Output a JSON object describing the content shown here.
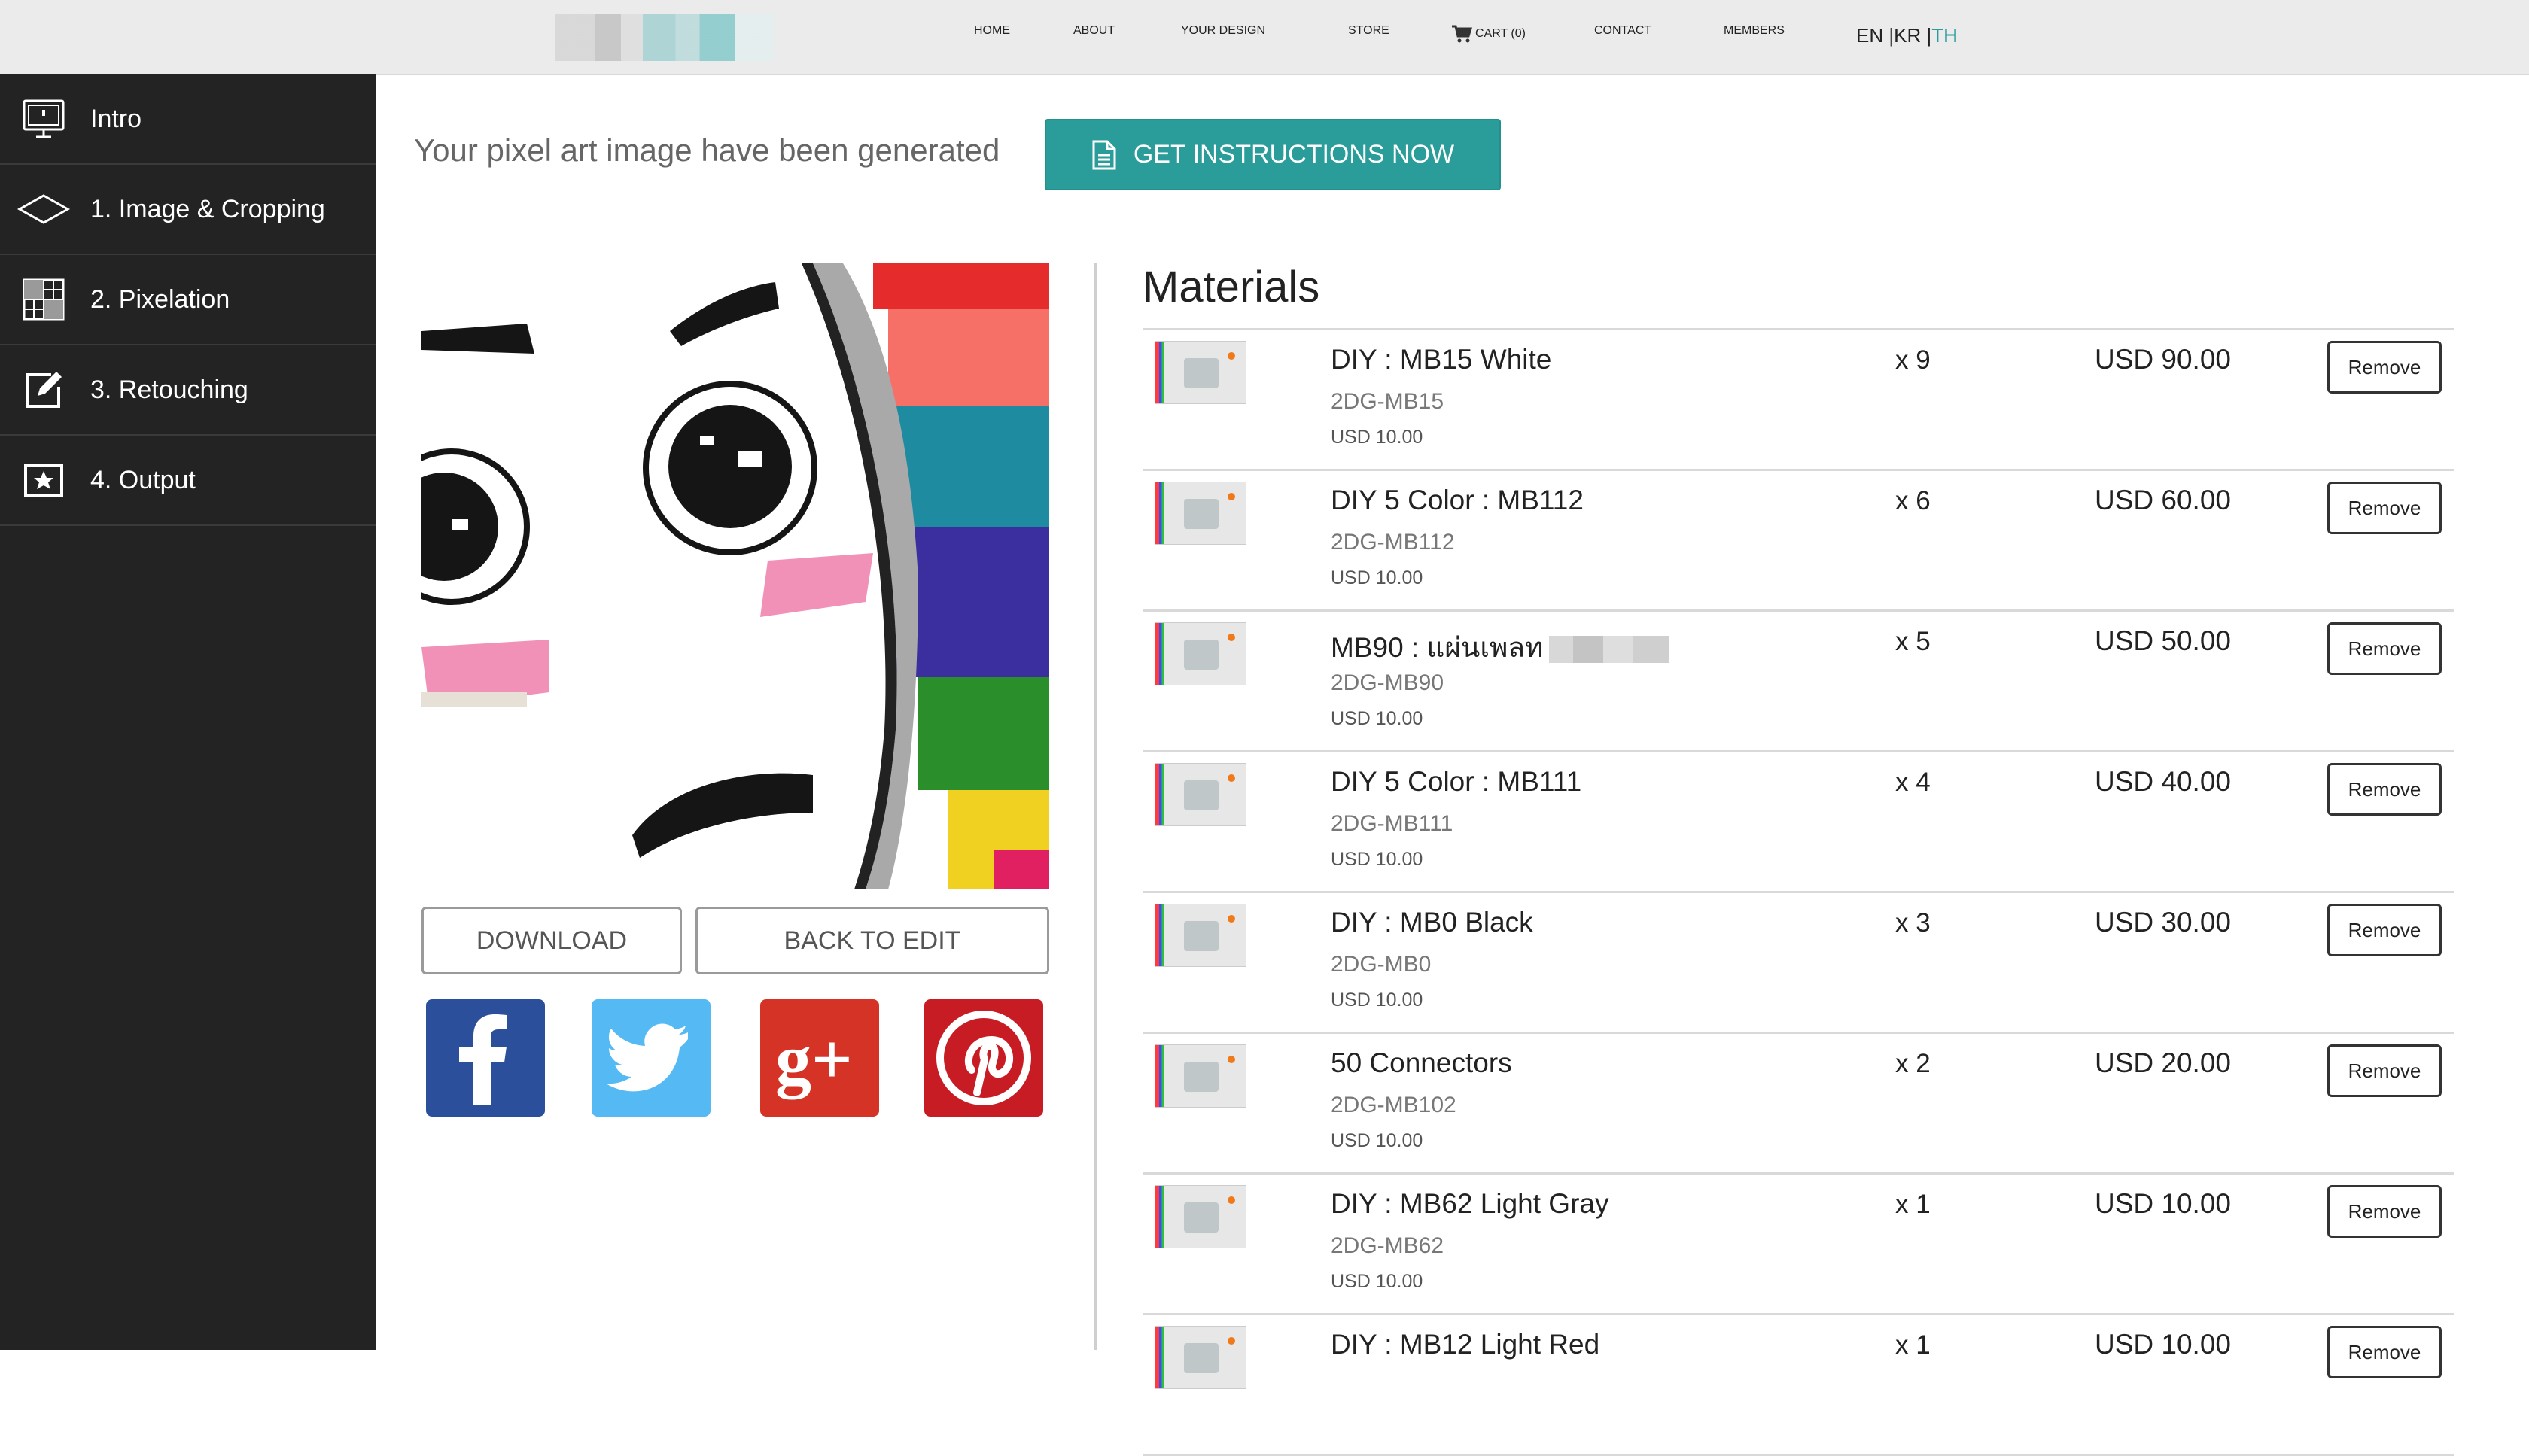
{
  "nav": {
    "items": [
      "HOME",
      "ABOUT",
      "YOUR DESIGN",
      "STORE",
      "CART (0)",
      "CONTACT",
      "MEMBERS"
    ],
    "lang": {
      "en": "EN",
      "kr": "KR",
      "th": "TH"
    }
  },
  "sidebar": {
    "items": [
      {
        "label": "Intro",
        "icon": "monitor-icon"
      },
      {
        "label": "1. Image & Cropping",
        "icon": "crop-icon"
      },
      {
        "label": "2. Pixelation",
        "icon": "pixel-grid-icon"
      },
      {
        "label": "3. Retouching",
        "icon": "edit-icon"
      },
      {
        "label": "4. Output",
        "icon": "star-icon"
      }
    ]
  },
  "main": {
    "generated_text": "Your pixel art image have been generated",
    "instructions_label": "GET INSTRUCTIONS NOW",
    "download_label": "DOWNLOAD",
    "back_label": "BACK TO EDIT"
  },
  "social": [
    "facebook",
    "twitter",
    "google-plus",
    "pinterest"
  ],
  "materials": {
    "title": "Materials",
    "remove_label": "Remove",
    "rows": [
      {
        "name": "DIY : MB15 White",
        "code": "2DG-MB15",
        "unit": "USD 10.00",
        "qty": "x 9",
        "total": "USD 90.00"
      },
      {
        "name": "DIY 5 Color : MB112",
        "code": "2DG-MB112",
        "unit": "USD 10.00",
        "qty": "x 6",
        "total": "USD 60.00"
      },
      {
        "name": "MB90 : แผ่นเพลท",
        "code": "2DG-MB90",
        "unit": "USD 10.00",
        "qty": "x 5",
        "total": "USD 50.00"
      },
      {
        "name": "DIY 5 Color : MB111",
        "code": "2DG-MB111",
        "unit": "USD 10.00",
        "qty": "x 4",
        "total": "USD 40.00"
      },
      {
        "name": "DIY : MB0 Black",
        "code": "2DG-MB0",
        "unit": "USD 10.00",
        "qty": "x 3",
        "total": "USD 30.00"
      },
      {
        "name": "50 Connectors",
        "code": "2DG-MB102",
        "unit": "USD 10.00",
        "qty": "x 2",
        "total": "USD 20.00"
      },
      {
        "name": "DIY : MB62 Light Gray",
        "code": "2DG-MB62",
        "unit": "USD 10.00",
        "qty": "x 1",
        "total": "USD 10.00"
      },
      {
        "name": "DIY : MB12 Light Red",
        "code": "",
        "unit": "",
        "qty": "x 1",
        "total": "USD 10.00"
      }
    ]
  },
  "colors": {
    "accent": "#2a9d9b",
    "sidebar_bg": "#232323",
    "topbar_bg": "#ebebeb"
  }
}
